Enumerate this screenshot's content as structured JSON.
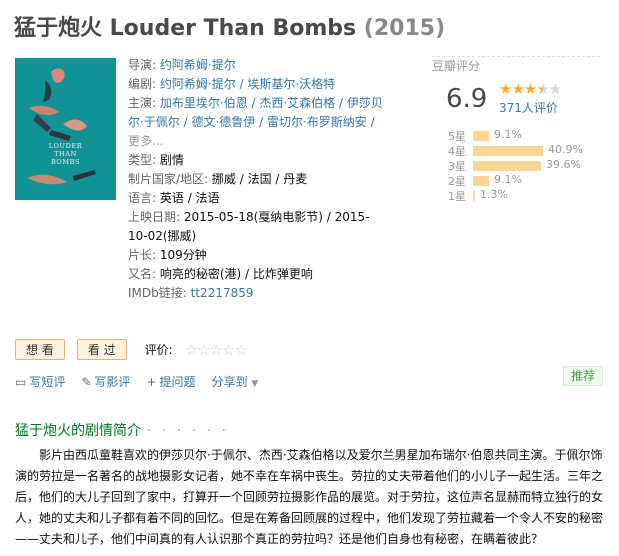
{
  "title": "猛于炮火 Louder Than Bombs",
  "year": "(2015)",
  "poster": {
    "line1": "LOUDER",
    "line2": "THAN",
    "line3": "BOMBS"
  },
  "info": {
    "director_label": "导演:",
    "director": "约阿希姆·提尔",
    "writer_label": "编剧:",
    "writer": "约阿希姆·提尔 / 埃斯基尔·沃格特",
    "cast_label": "主演:",
    "cast": "加布里埃尔·伯恩 / 杰西·艾森伯格 / 伊莎贝尔·于佩尔 / 德文·德鲁伊 / 雷切尔·布罗斯纳安 /",
    "more": "更多...",
    "genre_label": "类型:",
    "genre": "剧情",
    "country_label": "制片国家/地区:",
    "country": "挪威 / 法国 / 丹麦",
    "language_label": "语言:",
    "language": "英语 / 法语",
    "release_label": "上映日期:",
    "release": "2015-05-18(戛纳电影节) / 2015-10-02(挪威)",
    "runtime_label": "片长:",
    "runtime": "109分钟",
    "aka_label": "又名:",
    "aka": "响亮的秘密(港) / 比炸弹更响",
    "imdb_label": "IMDb链接:",
    "imdb": "tt2217859"
  },
  "rating": {
    "title": "豆瓣评分",
    "score": "6.9",
    "stars_full": "★★★",
    "stars_half": "★",
    "stars_empty": "★",
    "votes": "371人评价",
    "distribution": [
      {
        "label": "5星",
        "pct": "9.1%",
        "value": 9.1
      },
      {
        "label": "4星",
        "pct": "40.9%",
        "value": 40.9
      },
      {
        "label": "3星",
        "pct": "39.6%",
        "value": 39.6
      },
      {
        "label": "2星",
        "pct": "9.1%",
        "value": 9.1
      },
      {
        "label": "1星",
        "pct": "1.3%",
        "value": 1.3
      }
    ]
  },
  "buttons": {
    "wish": "想 看",
    "seen": "看 过",
    "rate_label": "评价:",
    "rate_stars": "☆☆☆☆☆"
  },
  "actions": {
    "write_review": "写短评",
    "write_long_review": "写影评",
    "ask": "提问题",
    "share": "分享到",
    "recommend": "推荐"
  },
  "synopsis": {
    "title": "猛于炮火的剧情简介",
    "dots": "· · · · · ·",
    "text": "影片由西瓜童鞋喜欢的伊莎贝尔·于佩尔、杰西·艾森伯格以及爱尔兰男星加布瑞尔·伯恩共同主演。于佩尔饰演的劳拉是一名著名的战地摄影女记者，她不幸在车祸中丧生。劳拉的丈夫带着他们的小儿子一起生活。三年之后，他们的大儿子回到了家中，打算开一个回顾劳拉摄影作品的展览。对于劳拉，这位声名显赫而特立独行的女人，她的丈夫和儿子都有着不同的回忆。但是在筹备回顾展的过程中，他们发现了劳拉藏着一个令人不安的秘密——丈夫和儿子，他们中间真的有人认识那个真正的劳拉吗？还是他们自身也有秘密，在瞒着彼此？"
  }
}
